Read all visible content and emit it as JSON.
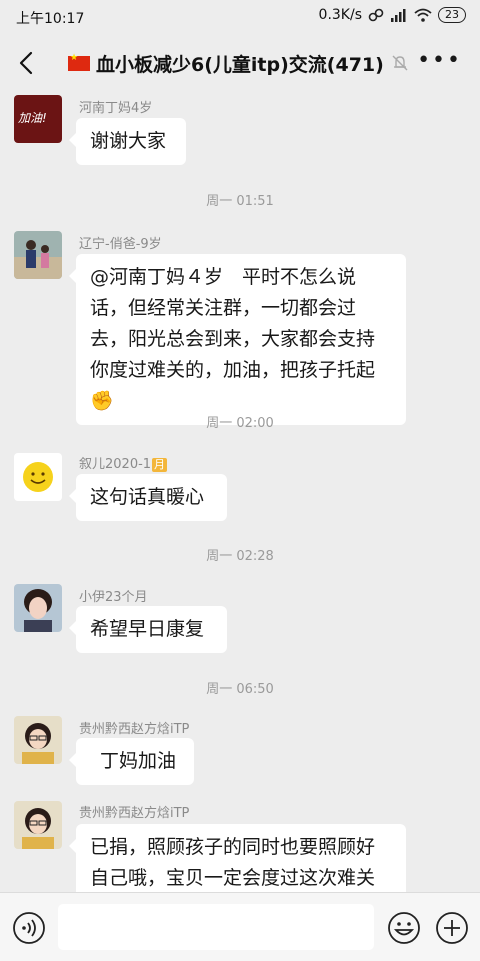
{
  "status": {
    "time": "上午10:17",
    "speed": "0.3K/s",
    "battery": "23"
  },
  "header": {
    "title": "血小板减少6(儿童itp)交流(471)"
  },
  "messages": [
    {
      "nick": "河南丁妈4岁",
      "text": "谢谢大家",
      "avatar_text": "加油!"
    },
    {
      "nick": "辽宁-俏爸-9岁",
      "text": "@河南丁妈４岁　平时不怎么说话，但经常关注群，一切都会过去，阳光总会到来，大家都会支持你度过难关的，加油，把孩子托起",
      "emoji": "✊"
    },
    {
      "nick": "叙儿2020-1",
      "nick_badge": "月",
      "text": "这句话真暖心"
    },
    {
      "nick": "小伊23个月",
      "text": "希望早日康复"
    },
    {
      "nick": "贵州黔西赵方焓iTP",
      "text": "丁妈加油"
    },
    {
      "nick": "贵州黔西赵方焓iTP",
      "text": "已捐，照顾孩子的同时也要照顾好自己哦，宝贝一定会度过这次难关"
    }
  ],
  "timestamps": [
    "周一 01:51",
    "周一 02:00",
    "周一 02:28",
    "周一 06:50"
  ],
  "icons": {
    "back": "back-arrow-icon",
    "mute": "mute-bell-icon",
    "more": "more-dots-icon",
    "voice": "voice-icon",
    "emoji": "emoji-icon",
    "plus": "plus-icon"
  },
  "colors": {
    "background": "#ededed",
    "bubble": "#ffffff",
    "flag": "#de2910"
  }
}
